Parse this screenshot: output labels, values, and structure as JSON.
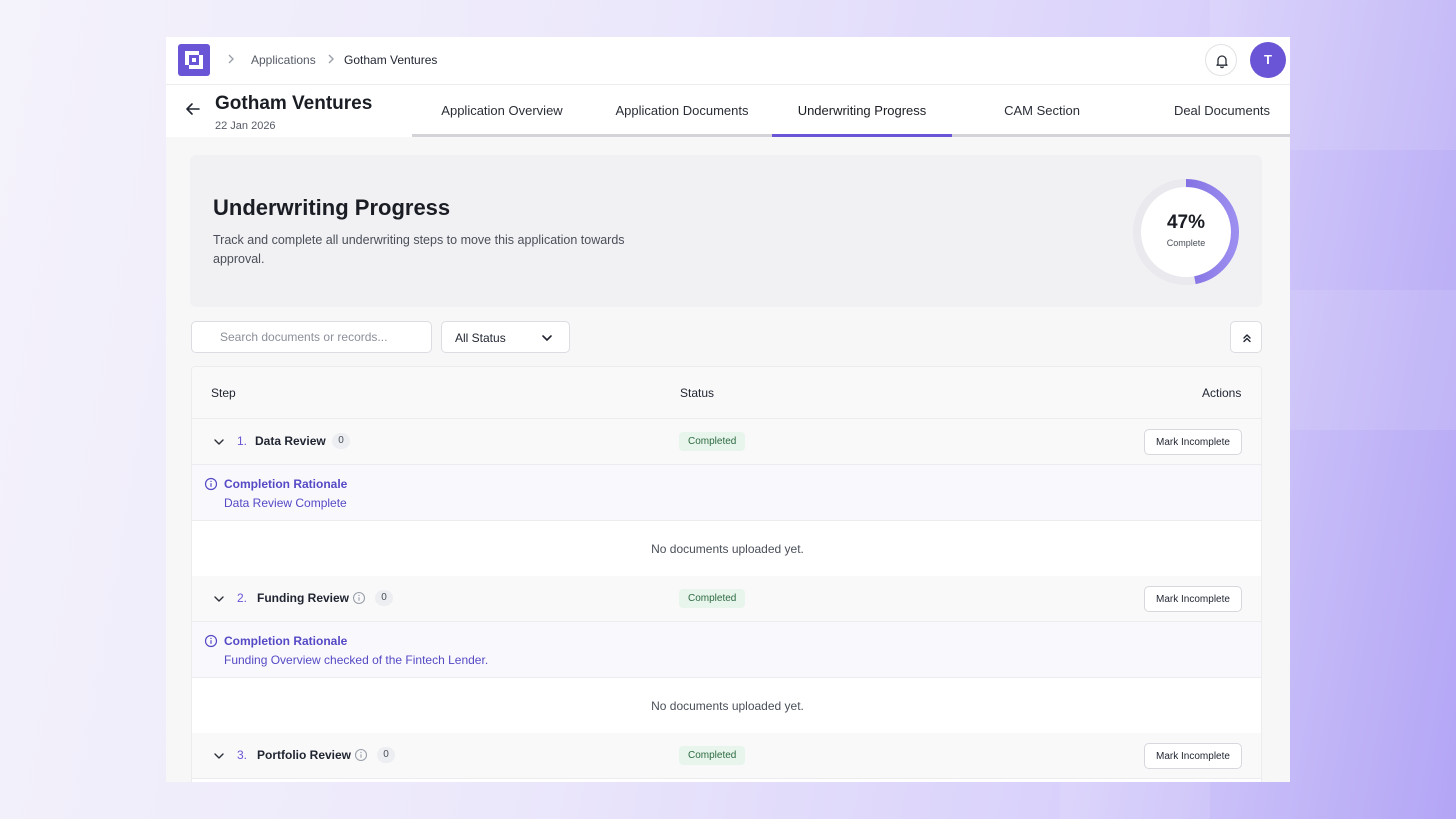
{
  "breadcrumb": {
    "items": [
      "Applications",
      "Gotham Ventures"
    ]
  },
  "user": {
    "initial": "T"
  },
  "header": {
    "title": "Gotham Ventures",
    "date": "22 Jan 2026"
  },
  "tabs": [
    {
      "label": "Application Overview"
    },
    {
      "label": "Application Documents"
    },
    {
      "label": "Underwriting Progress"
    },
    {
      "label": "CAM Section"
    },
    {
      "label": "Deal Documents"
    }
  ],
  "active_tab": "Underwriting Progress",
  "hero": {
    "title": "Underwriting Progress",
    "description": "Track and complete all underwriting steps to move this application towards approval.",
    "progress_fraction": 0.47,
    "progress_label": "47%",
    "progress_sublabel": "Complete"
  },
  "filters": {
    "search_placeholder": "Search documents or records...",
    "status_selected": "All Status"
  },
  "table": {
    "columns": {
      "step": "Step",
      "status": "Status",
      "actions": "Actions"
    },
    "rationale_title": "Completion Rationale",
    "no_docs": "No documents uploaded yet.",
    "steps": [
      {
        "num": "1.",
        "name": "Data Review",
        "count": "0",
        "status": "Completed",
        "action": "Mark Incomplete",
        "rationale": "Data Review Complete"
      },
      {
        "num": "2.",
        "name": "Funding Review",
        "count": "0",
        "status": "Completed",
        "action": "Mark Incomplete",
        "rationale": "Funding Overview checked of the Fintech Lender."
      },
      {
        "num": "3.",
        "name": "Portfolio Review",
        "count": "0",
        "status": "Completed",
        "action": "Mark Incomplete"
      }
    ]
  },
  "colors": {
    "accent": "#6a55d6",
    "status_bg": "#e8f5ec",
    "status_text": "#2d6a41",
    "rationale_text": "#5549c5"
  },
  "icons": [
    "logo-icon",
    "chevron-right-icon",
    "bell-icon",
    "arrow-left-icon",
    "chevron-down-icon",
    "chevrons-up-icon",
    "info-icon"
  ]
}
